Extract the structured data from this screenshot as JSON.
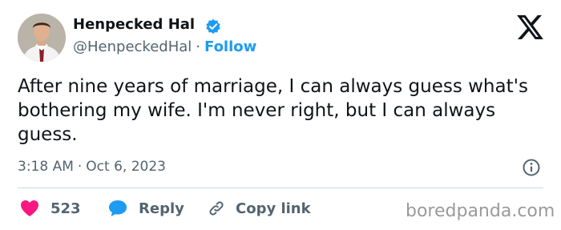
{
  "author": {
    "name": "Henpecked Hal",
    "handle": "@HenpeckedHal",
    "separator": "·",
    "follow_label": "Follow",
    "verified": true
  },
  "tweet": {
    "text": "After nine years of marriage, I can always guess what's bothering my wife. I'm never right, but I can always guess.",
    "time": "3:18 AM",
    "separator": "·",
    "date": "Oct 6, 2023"
  },
  "actions": {
    "like_count": "523",
    "reply_label": "Reply",
    "copy_label": "Copy link"
  },
  "icons": {
    "logo": "x-logo-icon",
    "verified": "verified-badge-icon",
    "info": "info-icon",
    "like": "heart-icon",
    "reply": "speech-bubble-icon",
    "copy": "link-icon"
  },
  "colors": {
    "accent": "#1d9bf0",
    "like": "#f91880",
    "text": "#0f1419",
    "muted": "#536471"
  },
  "watermark": "boredpanda.com"
}
